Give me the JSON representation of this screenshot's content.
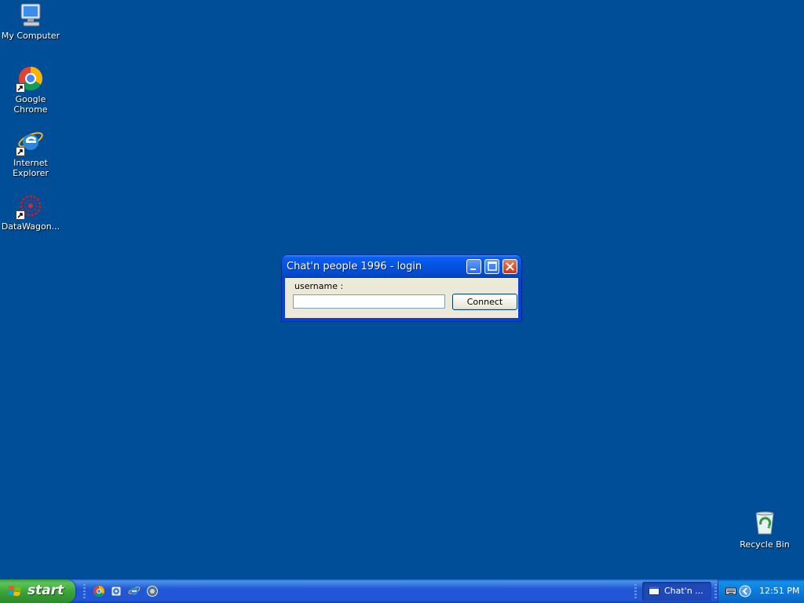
{
  "desktop": {
    "icons": [
      {
        "label": "My Computer",
        "icon": "my-computer-icon"
      },
      {
        "label": "Google Chrome",
        "icon": "chrome-icon"
      },
      {
        "label_line1": "Internet",
        "label_line2": "Explorer",
        "icon": "internet-explorer-icon"
      },
      {
        "label": "DataWagon...",
        "icon": "datawagon-icon"
      },
      {
        "label": "Recycle Bin",
        "icon": "recycle-bin-icon"
      }
    ]
  },
  "dialog": {
    "title": "Chat'n people 1996 - login",
    "username_label": "username :",
    "username_value": "",
    "connect_label": "Connect"
  },
  "taskbar": {
    "start_label": "start",
    "quick_launch": [
      "chrome-icon",
      "media-icon",
      "internet-explorer-icon",
      "globe-icon"
    ],
    "task_button_label": "Chat'n ...",
    "clock": "12:51 PM"
  },
  "colors": {
    "desktop": "#004e98",
    "titlebar": "#0453e0",
    "taskbar": "#2157d7",
    "start": "#38a236",
    "tray": "#0c77d7"
  }
}
